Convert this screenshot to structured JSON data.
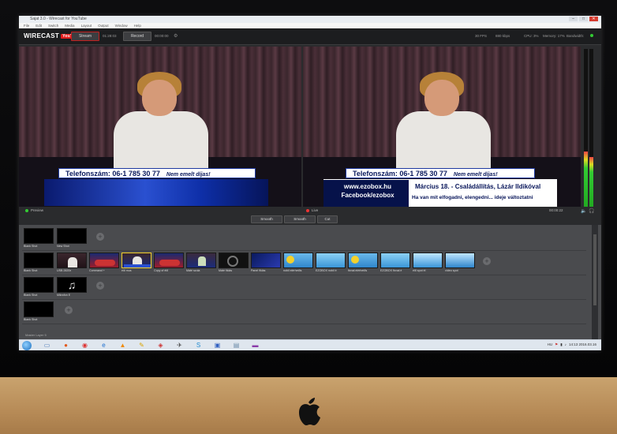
{
  "window": {
    "title": "Sajat 3.0 - Wirecast for YouTube",
    "controls": [
      "–",
      "□",
      "✕"
    ]
  },
  "menu": [
    "File",
    "Edit",
    "Switch",
    "Media",
    "Layout",
    "Output",
    "Window",
    "Help"
  ],
  "toolbar": {
    "logo_text": "WIRECAST",
    "logo_badge": "YouTube",
    "stream_label": "Stream",
    "stream_time": "01:28:03",
    "record_label": "Record",
    "record_time": "00:00:00",
    "fps": "30 FPS",
    "bitrate": "880 kbps",
    "cpu": "CPU: 3%",
    "memory": "Memory: 17%",
    "bandwidth": "Bandwidth:",
    "colors": {
      "stream_border": "#c02020",
      "youtube_red": "#e31c1c"
    }
  },
  "preview": {
    "label": "Preview",
    "lower_third": {
      "phone": "Telefonszám: 06-1 785 30 77",
      "note": "Nem emelt díjas!"
    }
  },
  "live": {
    "label": "Live",
    "time": "00:00:22",
    "lower_third": {
      "phone": "Telefonszám: 06-1 785 30 77",
      "note": "Nem emelt díjas!",
      "website": "www.ezobox.hu",
      "facebook": "Facebook/ezobox",
      "date_line": "Március 18. - Családállítás, Lázár Ildikóval",
      "tagline": "Ha van mit elfogadni, elengedni... ideje változtatni"
    },
    "audio_level": 0.35
  },
  "transitions": [
    "Smooth",
    "Smooth",
    "Cut"
  ],
  "layers": {
    "row1": [
      "Blank Shot",
      "New Shot"
    ],
    "row2": [
      "Blank Shot",
      "USB 2820x",
      "Command +",
      "élő mus",
      "Copy of élő",
      "Máté szola",
      "Máté fiklás",
      "Panel fiklás",
      "nobil elérhetős",
      "EZOBOX nobil é",
      "fixnal elérhetős",
      "EZOBOX fixnal é",
      "élő spot él",
      "vídeo spot"
    ],
    "row3": [
      "Blank Shot",
      "Mikrofon E"
    ],
    "row4": [
      "Blank Shot"
    ],
    "footer": "Master Layer 5"
  },
  "taskbar": {
    "clock_time": "14:13",
    "clock_date": "2016.03.16",
    "lang": "HU"
  }
}
